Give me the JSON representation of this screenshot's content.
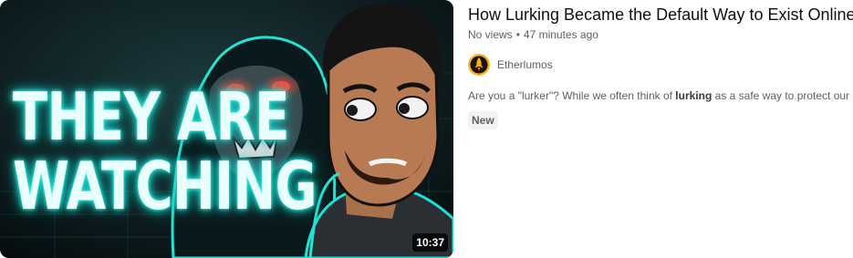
{
  "video": {
    "thumbnail_text_line1": "THEY ARE",
    "thumbnail_text_line2": "WATCHING",
    "duration": "10:37",
    "title": "How Lurking Became the Default Way to Exist Online",
    "views": "No views",
    "separator": "•",
    "age": "47 minutes ago",
    "channel_name": "Etherlumos",
    "description_before": "Are you a \"lurker\"? While we often think of ",
    "description_bold": "lurking",
    "description_after": " as a safe way to protect our p",
    "badge": "New"
  },
  "colors": {
    "neon": "#1be2d4",
    "meta_text": "#606060",
    "title_text": "#0f0f0f",
    "badge_bg": "#f2f2f2",
    "avatar_bg": "#f5b31b"
  },
  "icons": {
    "avatar": "channel-avatar-rocket"
  }
}
